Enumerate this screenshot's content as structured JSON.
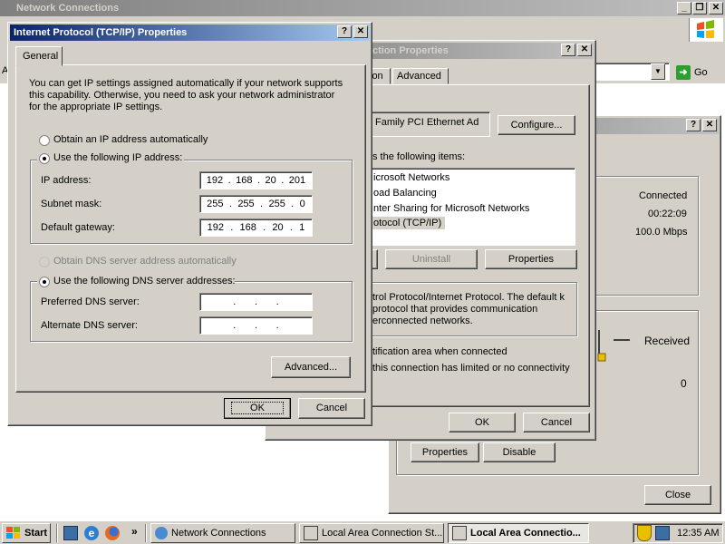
{
  "main_window": {
    "title": "Network Connections",
    "address_go": "Go",
    "address_left_char": "A"
  },
  "status_window": {
    "fields": [
      {
        "value": "Connected"
      },
      {
        "value": "00:22:09"
      },
      {
        "value": "100.0 Mbps"
      }
    ],
    "received_label": "Received",
    "received_value": "0",
    "properties": "Properties",
    "disable": "Disable",
    "close": "Close"
  },
  "lac_properties": {
    "title": "ction Properties",
    "tabs": [
      "ion",
      "Advanced"
    ],
    "adapter_name": "Family PCI Ethernet Ad",
    "configure": "Configure...",
    "uses_label": "s the following items:",
    "items": [
      "icrosoft Networks",
      "oad Balancing",
      "nter Sharing for Microsoft Networks",
      "otocol (TCP/IP)"
    ],
    "uninstall": "Uninstall",
    "properties": "Properties",
    "description": "trol Protocol/Internet Protocol. The default k protocol that provides communication erconnected networks.",
    "notify_icon": "tification area when connected",
    "notify_limited": "this connection has limited or no connectivity",
    "ok": "OK",
    "cancel": "Cancel"
  },
  "tcpip": {
    "title": "Internet Protocol (TCP/IP) Properties",
    "tab_general": "General",
    "intro": "You can get IP settings assigned automatically if your network supports this capability. Otherwise, you need to ask your network administrator for the appropriate IP settings.",
    "auto_ip": "Obtain an IP address automatically",
    "use_ip": "Use the following IP address:",
    "ip_label": "IP address:",
    "ip_value": [
      "192",
      "168",
      "20",
      "201"
    ],
    "mask_label": "Subnet mask:",
    "mask_value": [
      "255",
      "255",
      "255",
      "0"
    ],
    "gateway_label": "Default gateway:",
    "gateway_value": [
      "192",
      "168",
      "20",
      "1"
    ],
    "auto_dns": "Obtain DNS server address automatically",
    "use_dns": "Use the following DNS server addresses:",
    "pref_dns_label": "Preferred DNS server:",
    "alt_dns_label": "Alternate DNS server:",
    "advanced": "Advanced...",
    "ok": "OK",
    "cancel": "Cancel",
    "dot": "."
  },
  "taskbar": {
    "start": "Start",
    "tasks": [
      "Network Connections",
      "Local Area Connection St...",
      "Local Area Connectio..."
    ],
    "clock": "12:35 AM",
    "chevron": "»"
  }
}
